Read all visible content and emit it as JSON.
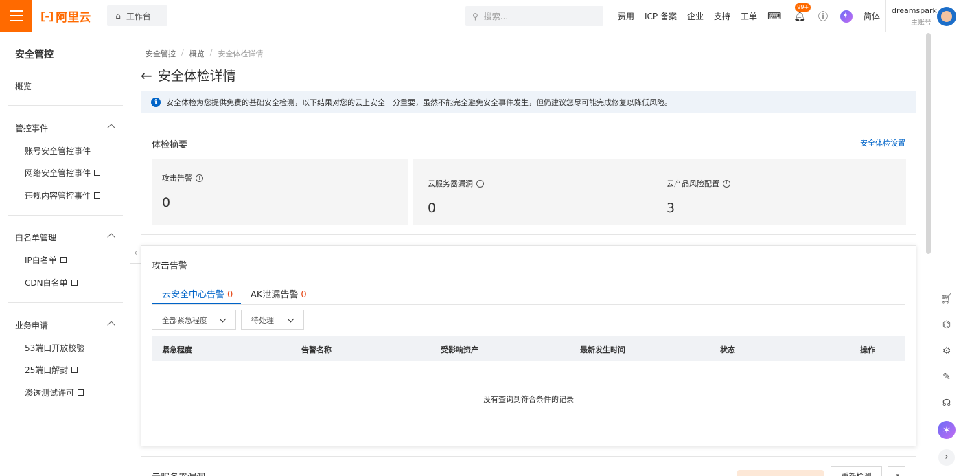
{
  "topbar": {
    "brand": "阿里云",
    "brand_mark": "[-]",
    "workbench": "工作台",
    "search_placeholder": "搜索...",
    "nav": [
      "费用",
      "ICP 备案",
      "企业",
      "支持",
      "工单"
    ],
    "notification_badge": "99+",
    "language": "简体",
    "account_name": "dreamspark",
    "account_type": "主账号"
  },
  "sidebar": {
    "title": "安全管控",
    "overview": "概览",
    "groups": [
      {
        "title": "管控事件",
        "items": [
          "账号安全管控事件",
          "网络安全管控事件",
          "违规内容管控事件"
        ]
      },
      {
        "title": "白名单管理",
        "items": [
          "IP白名单",
          "CDN白名单"
        ]
      },
      {
        "title": "业务申请",
        "items": [
          "53端口开放校验",
          "25端口解封",
          "渗透测试许可"
        ]
      }
    ]
  },
  "main": {
    "breadcrumb": [
      "安全管控",
      "概览",
      "安全体检详情"
    ],
    "title": "安全体检详情",
    "notice": "安全体检为您提供免费的基础安全检测，以下结果对您的云上安全十分重要，虽然不能完全避免安全事件发生，但仍建议您尽可能完成修复以降低风险。",
    "summary": {
      "title": "体检摘要",
      "settings_link": "安全体检设置",
      "stats": [
        {
          "label": "攻击告警",
          "value": "0"
        },
        {
          "label": "云服务器漏洞",
          "value": "0"
        },
        {
          "label": "云产品风险配置",
          "value": "3"
        }
      ]
    },
    "alerts": {
      "title": "攻击告警",
      "tabs": [
        {
          "label": "云安全中心告警",
          "count": "0"
        },
        {
          "label": "AK泄漏告警",
          "count": "0"
        }
      ],
      "filter_severity": "全部紧急程度",
      "filter_status": "待处理",
      "columns": [
        "紧急程度",
        "告警名称",
        "受影响资产",
        "最新发生时间",
        "状态",
        "操作"
      ],
      "empty_text": "没有查询到符合条件的记录"
    },
    "next_section_title": "云服务器漏洞",
    "recheck_button": "重新检测"
  },
  "colors": {
    "brand": "#ff6a00",
    "link": "#0064c8",
    "count_red": "#e64a19"
  }
}
